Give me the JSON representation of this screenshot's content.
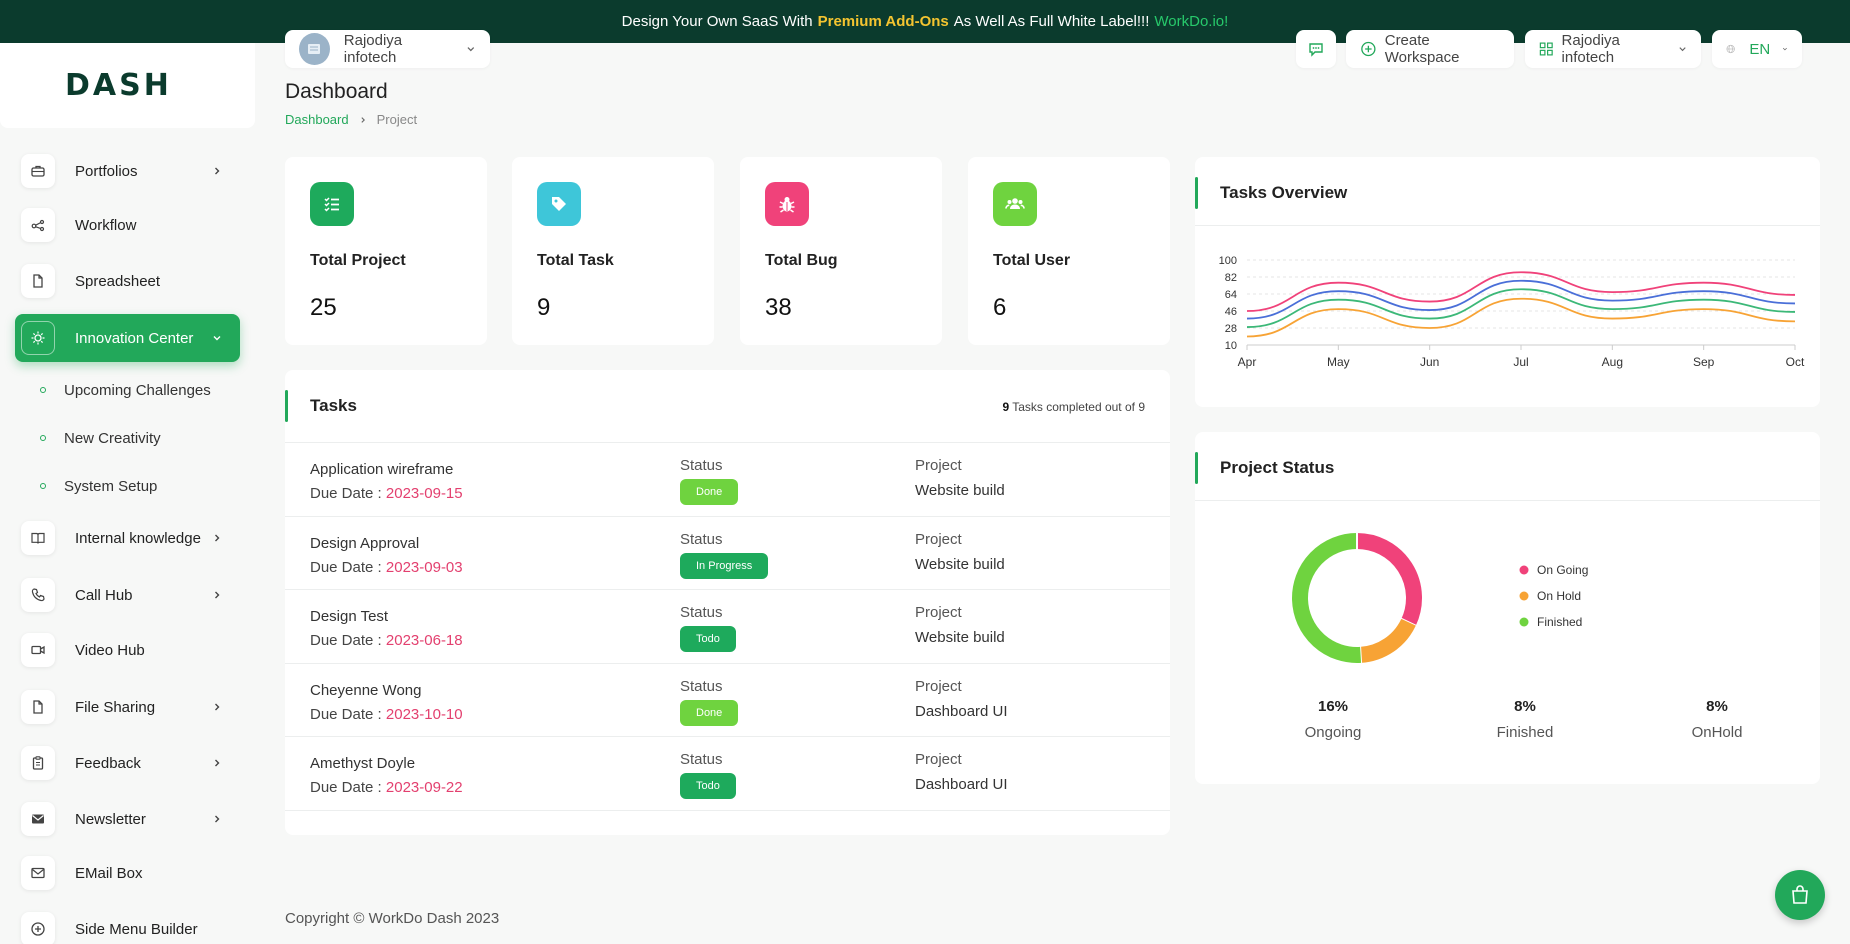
{
  "banner": {
    "text_before": "Design Your Own SaaS With",
    "highlight": "Premium Add-Ons",
    "text_after": "As Well As Full White Label!!!",
    "link": "WorkDo.io!",
    "colors": {
      "background": "#0b3b2d",
      "highlight": "#f4c430",
      "link": "#27c96b"
    }
  },
  "logo": {
    "text": "DASH"
  },
  "header": {
    "workspace_left": "Rajodiya infotech",
    "create_workspace": "Create Workspace",
    "workspace_right": "Rajodiya infotech",
    "language": "EN"
  },
  "sidebar": {
    "items": [
      {
        "label": "Portfolios",
        "icon": "briefcase-icon",
        "has_children": true
      },
      {
        "label": "Workflow",
        "icon": "workflow-icon",
        "has_children": false
      },
      {
        "label": "Spreadsheet",
        "icon": "file-icon",
        "has_children": false
      },
      {
        "label": "Innovation Center",
        "icon": "lightbulb-icon",
        "has_children": true,
        "active": true
      },
      {
        "label": "Internal knowledge",
        "icon": "book-icon",
        "has_children": true
      },
      {
        "label": "Call Hub",
        "icon": "phone-icon",
        "has_children": true
      },
      {
        "label": "Video Hub",
        "icon": "video-icon",
        "has_children": false
      },
      {
        "label": "File Sharing",
        "icon": "file-icon",
        "has_children": true
      },
      {
        "label": "Feedback",
        "icon": "clipboard-icon",
        "has_children": true
      },
      {
        "label": "Newsletter",
        "icon": "envelope-icon",
        "has_children": true
      },
      {
        "label": "EMail Box",
        "icon": "mail-icon",
        "has_children": false
      },
      {
        "label": "Side Menu Builder",
        "icon": "plus-circle-icon",
        "has_children": false
      }
    ],
    "subitems": [
      "Upcoming Challenges",
      "New Creativity",
      "System Setup"
    ],
    "accent": "#22a85a"
  },
  "page": {
    "title": "Dashboard",
    "breadcrumb": [
      "Dashboard",
      "Project"
    ]
  },
  "stats": [
    {
      "label": "Total Project",
      "value": "25",
      "color": "#1eaa5c",
      "icon": "list-check-icon"
    },
    {
      "label": "Total Task",
      "value": "9",
      "color": "#3ec6d9",
      "icon": "tag-icon"
    },
    {
      "label": "Total Bug",
      "value": "38",
      "color": "#f0427a",
      "icon": "bug-icon"
    },
    {
      "label": "Total User",
      "value": "6",
      "color": "#6fd33f",
      "icon": "users-icon"
    }
  ],
  "tasks": {
    "title": "Tasks",
    "completed_count": "9",
    "completed_text": "Tasks completed out of 9",
    "status_label": "Status",
    "project_label": "Project",
    "due_label": "Due Date :",
    "rows": [
      {
        "name": "Application wireframe",
        "due": "2023-09-15",
        "status": "Done",
        "status_color": "#6fd33f",
        "project": "Website build"
      },
      {
        "name": "Design Approval",
        "due": "2023-09-03",
        "status": "In Progress",
        "status_color": "#1eaa5c",
        "project": "Website build"
      },
      {
        "name": "Design Test",
        "due": "2023-06-18",
        "status": "Todo",
        "status_color": "#1eaa5c",
        "project": "Website build"
      },
      {
        "name": "Cheyenne Wong",
        "due": "2023-10-10",
        "status": "Done",
        "status_color": "#6fd33f",
        "project": "Dashboard UI"
      },
      {
        "name": "Amethyst Doyle",
        "due": "2023-09-22",
        "status": "Todo",
        "status_color": "#1eaa5c",
        "project": "Dashboard UI"
      }
    ]
  },
  "tasks_overview": {
    "title": "Tasks Overview",
    "chart_data": {
      "type": "line",
      "categories": [
        "Apr",
        "May",
        "Jun",
        "Jul",
        "Aug",
        "Sep",
        "Oct"
      ],
      "ylim": [
        10,
        100
      ],
      "yticks": [
        "100",
        "82",
        "64",
        "46",
        "28",
        "10"
      ],
      "grid": true,
      "series": [
        {
          "color": "#f0427a",
          "values": [
            46,
            76,
            56,
            87,
            66,
            76,
            63
          ]
        },
        {
          "color": "#4a6fd8",
          "values": [
            38,
            67,
            47,
            78,
            57,
            67,
            54
          ]
        },
        {
          "color": "#3cb878",
          "values": [
            29,
            58,
            38,
            69,
            48,
            58,
            45
          ]
        },
        {
          "color": "#f7a335",
          "values": [
            19,
            48,
            28,
            59,
            38,
            48,
            35
          ]
        }
      ]
    }
  },
  "project_status": {
    "title": "Project Status",
    "chart_data": {
      "type": "pie",
      "donut": true,
      "labels": [
        "On Going",
        "On Hold",
        "Finished"
      ],
      "values": [
        32,
        17,
        51
      ],
      "colors": [
        "#f0427a",
        "#f7a335",
        "#6fd33f"
      ],
      "legend": "right"
    },
    "summary": [
      {
        "value": "16%",
        "label": "Ongoing"
      },
      {
        "value": "8%",
        "label": "Finished"
      },
      {
        "value": "8%",
        "label": "OnHold"
      }
    ]
  },
  "footer": {
    "text": "Copyright © WorkDo Dash 2023"
  }
}
